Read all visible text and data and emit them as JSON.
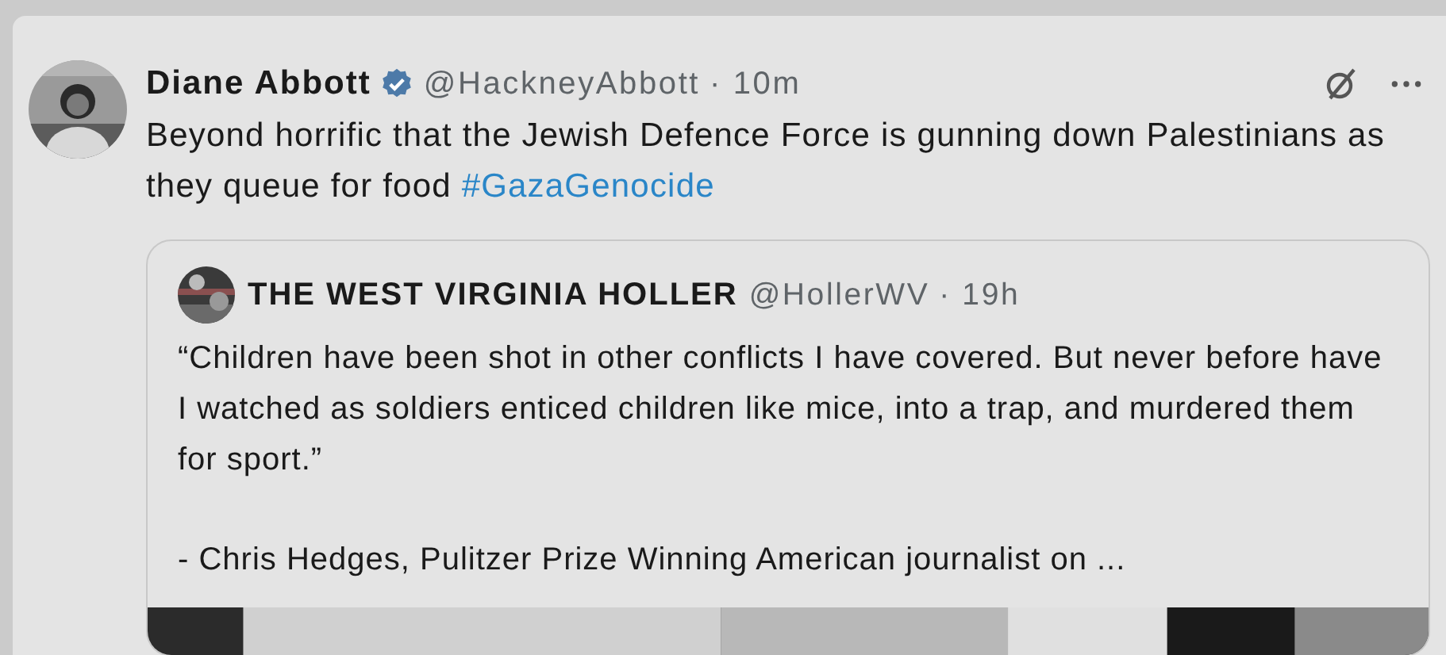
{
  "post": {
    "author": {
      "name": "Diane Abbott",
      "verified": true,
      "handle": "@HackneyAbbott",
      "time": "· 10m"
    },
    "text": "Beyond horrific that the Jewish Defence Force is gunning down Palestinians as they queue for food",
    "hashtag": "#GazaGenocide",
    "quote": {
      "author": {
        "name": "THE WEST VIRGINIA HOLLER",
        "handle": "@HollerWV",
        "time": "· 19h"
      },
      "paragraphs": [
        "“Children have been shot in other conflicts I have covered. But never before have I watched as soldiers enticed children like mice, into a trap, and murdered them for sport.”",
        "- Chris Hedges, Pulitzer Prize Winning American journalist on ..."
      ]
    }
  }
}
